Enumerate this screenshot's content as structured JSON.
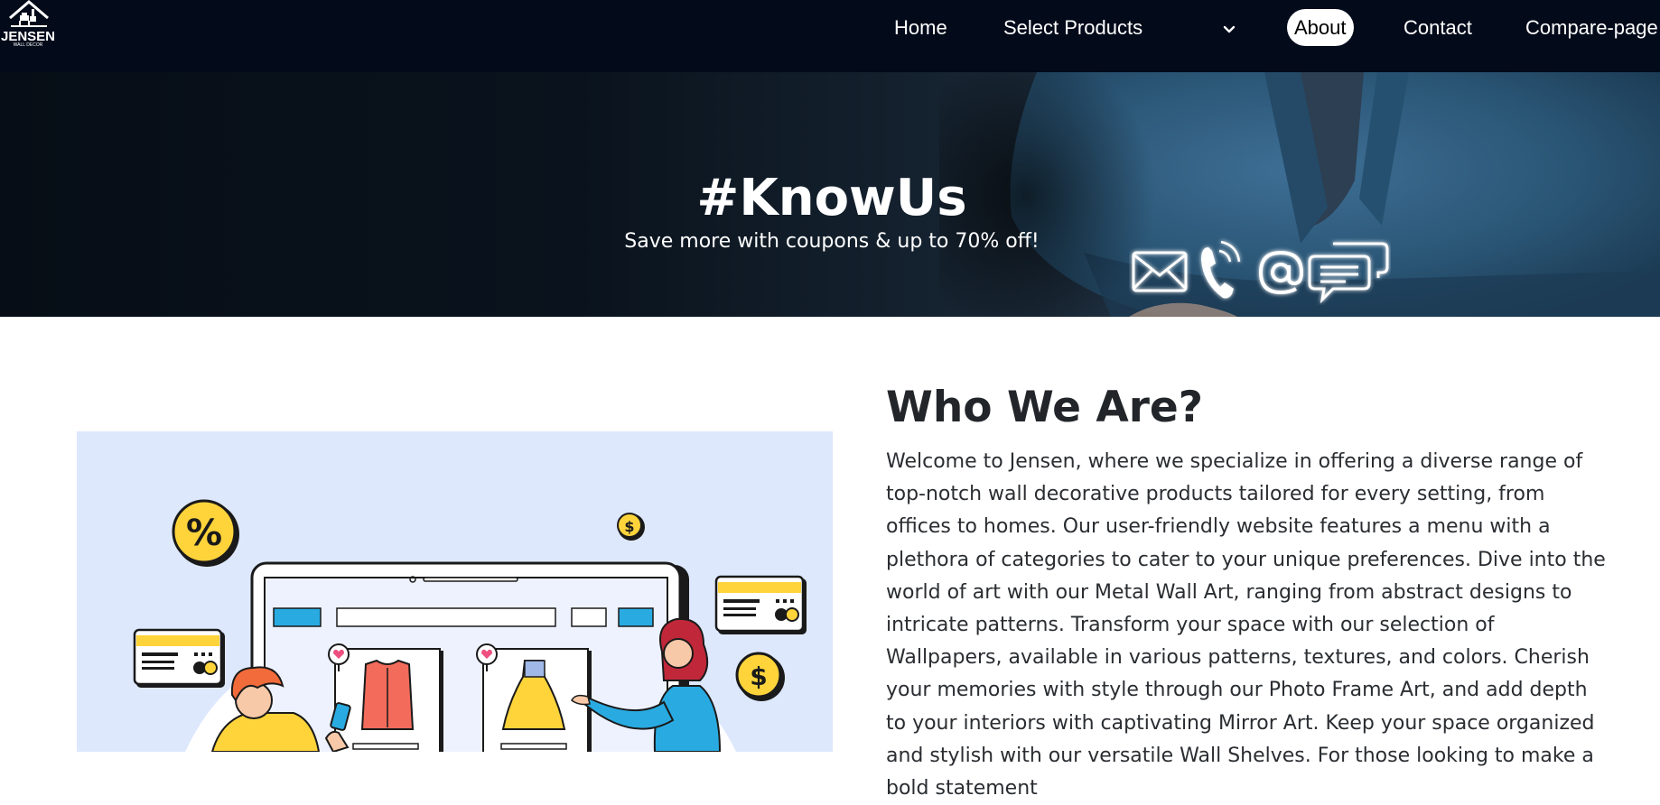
{
  "brand": {
    "name": "JENSEN",
    "tagline": "WALL DECOR",
    "logo_icon": "house-logo-icon"
  },
  "nav": {
    "home": "Home",
    "select_products": "Select Products",
    "dropdown_icon": "chevron-down-icon",
    "about": "About",
    "contact": "Contact",
    "compare": "Compare-page",
    "active": "About"
  },
  "hero": {
    "title": "#KnowUs",
    "subtitle": "Save more with coupons & up to 70% off!",
    "icons": [
      "mail-icon",
      "phone-icon",
      "at-sign-icon",
      "chat-bubbles-icon"
    ]
  },
  "about": {
    "heading": "Who We Are?",
    "body": "Welcome to Jensen, where we specialize in offering a diverse range of top-notch wall decorative products tailored for every setting, from offices to homes. Our user-friendly website features a menu with a plethora of categories to cater to your unique preferences. Dive into the world of art with our Metal Wall Art, ranging from abstract designs to intricate patterns. Transform your space with our selection of Wallpapers, available in various patterns, textures, and colors. Cherish your memories with style through our Photo Frame Art, and add depth to your interiors with captivating Mirror Art. Keep your space organized and stylish with our versatile Wall Shelves. For those looking to make a bold statement"
  },
  "illustration": {
    "percent_symbol": "%",
    "dollar_symbol": "$",
    "icons": [
      "percent-badge-icon",
      "dollar-coin-icon",
      "credit-card-icon",
      "shopping-laptop-icon"
    ]
  },
  "colors": {
    "navbar_bg": "#030a1a",
    "illustration_bg": "#dde8fd",
    "accent_yellow": "#ffd43b",
    "accent_blue": "#29abe2"
  }
}
